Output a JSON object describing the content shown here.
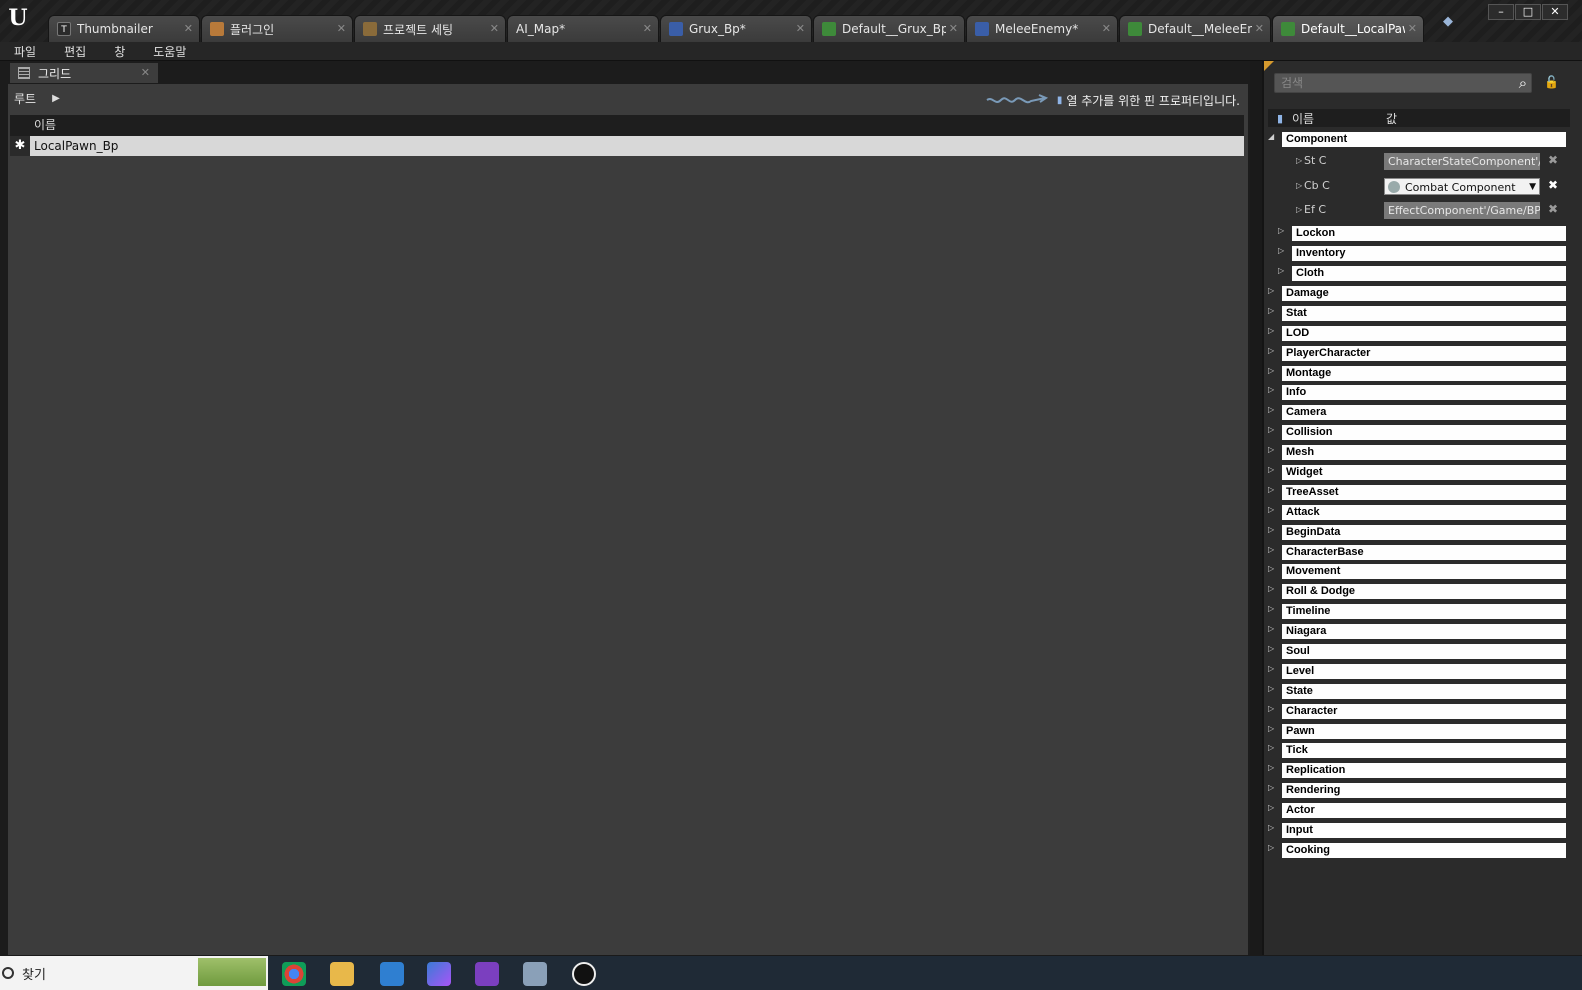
{
  "tabs": [
    {
      "label": "Thumbnailer",
      "icon": "t-asset-icon",
      "icon_class": "ic-t",
      "icon_text": "T",
      "active": false
    },
    {
      "label": "플러그인",
      "icon": "plugin-icon",
      "icon_class": "ic-plug",
      "icon_text": "",
      "active": false
    },
    {
      "label": "프로젝트 세팅",
      "icon": "settings-gear-icon",
      "icon_class": "ic-gear",
      "icon_text": "",
      "active": false
    },
    {
      "label": "AI_Map*",
      "icon": "",
      "icon_class": "ic-none",
      "icon_text": "",
      "active": false
    },
    {
      "label": "Grux_Bp*",
      "icon": "pawn-blueprint-icon",
      "icon_class": "ic-pawn-blue",
      "icon_text": "",
      "active": false
    },
    {
      "label": "Default__Grux_Bp_*",
      "icon": "pawn-default-icon",
      "icon_class": "ic-pawn-green",
      "icon_text": "",
      "active": false
    },
    {
      "label": "MeleeEnemy*",
      "icon": "pawn-blueprint-icon",
      "icon_class": "ic-pawn-blue",
      "icon_text": "",
      "active": false
    },
    {
      "label": "Default__MeleeEne*",
      "icon": "pawn-default-icon",
      "icon_class": "ic-pawn-green",
      "icon_text": "",
      "active": false
    },
    {
      "label": "Default__LocalPaw*",
      "icon": "pawn-default-icon",
      "icon_class": "ic-pawn-green",
      "icon_text": "",
      "active": true
    }
  ],
  "menu": [
    "파일",
    "편집",
    "창",
    "도움말"
  ],
  "grid_panel": {
    "tab_label": "그리드",
    "root_label": "루트",
    "pin_hint": "열 추가를 위한 핀 프로퍼티입니다.",
    "column_name": "이름",
    "row_label": "LocalPawn_Bp"
  },
  "details": {
    "search_placeholder": "검색",
    "col_name": "이름",
    "col_value": "값",
    "component_category": "Component",
    "component_props": [
      {
        "name": "St C",
        "value": "CharacterStateComponent'/Ga",
        "type": "text"
      },
      {
        "name": "Cb C",
        "value": "Combat Component",
        "type": "dropdown"
      },
      {
        "name": "Ef C",
        "value": "EffectComponent'/Game/BP/C",
        "type": "text"
      }
    ],
    "sub_categories": [
      "Lockon",
      "Inventory",
      "Cloth"
    ],
    "categories": [
      "Damage",
      "Stat",
      "LOD",
      "PlayerCharacter",
      "Montage",
      "Info",
      "Camera",
      "Collision",
      "Mesh",
      "Widget",
      "TreeAsset",
      "Attack",
      "BeginData",
      "CharacterBase",
      "Movement",
      "Roll & Dodge",
      "Timeline",
      "Niagara",
      "Soul",
      "Level",
      "State",
      "Character",
      "Pawn",
      "Tick",
      "Replication",
      "Rendering",
      "Actor",
      "Input",
      "Cooking"
    ]
  },
  "taskbar": {
    "search_label": "찾기"
  }
}
